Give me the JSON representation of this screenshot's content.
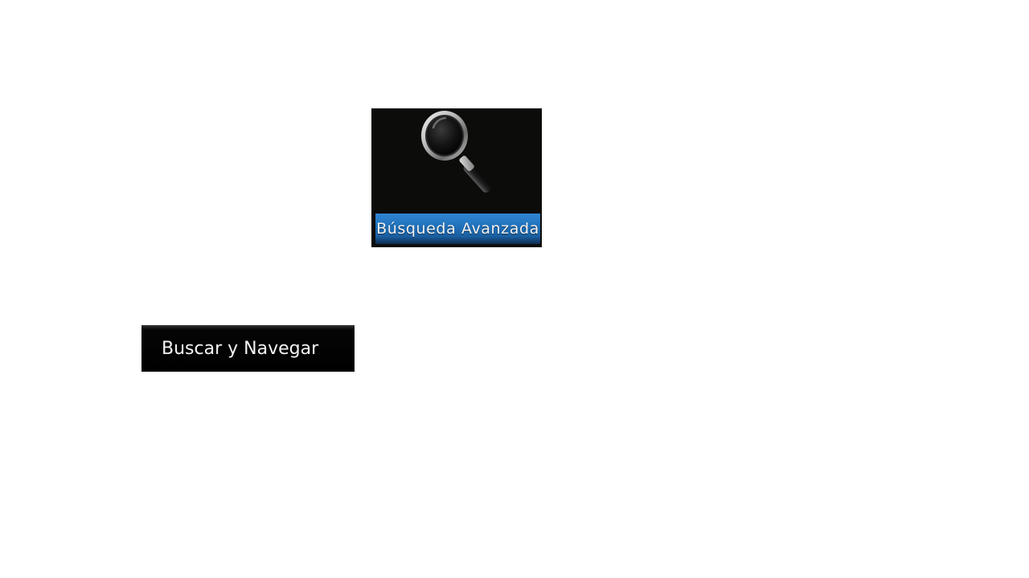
{
  "advanced_search_tile": {
    "icon": "magnifying-glass-icon",
    "label": "Búsqueda Avanzada",
    "colors": {
      "background": "#0c0c0a",
      "label_bar": "#1f6fb8",
      "label_text": "#f2f2f2"
    }
  },
  "browse_button": {
    "label": "Buscar y Navegar",
    "colors": {
      "background": "#000000",
      "text": "#f4f4f4"
    }
  }
}
